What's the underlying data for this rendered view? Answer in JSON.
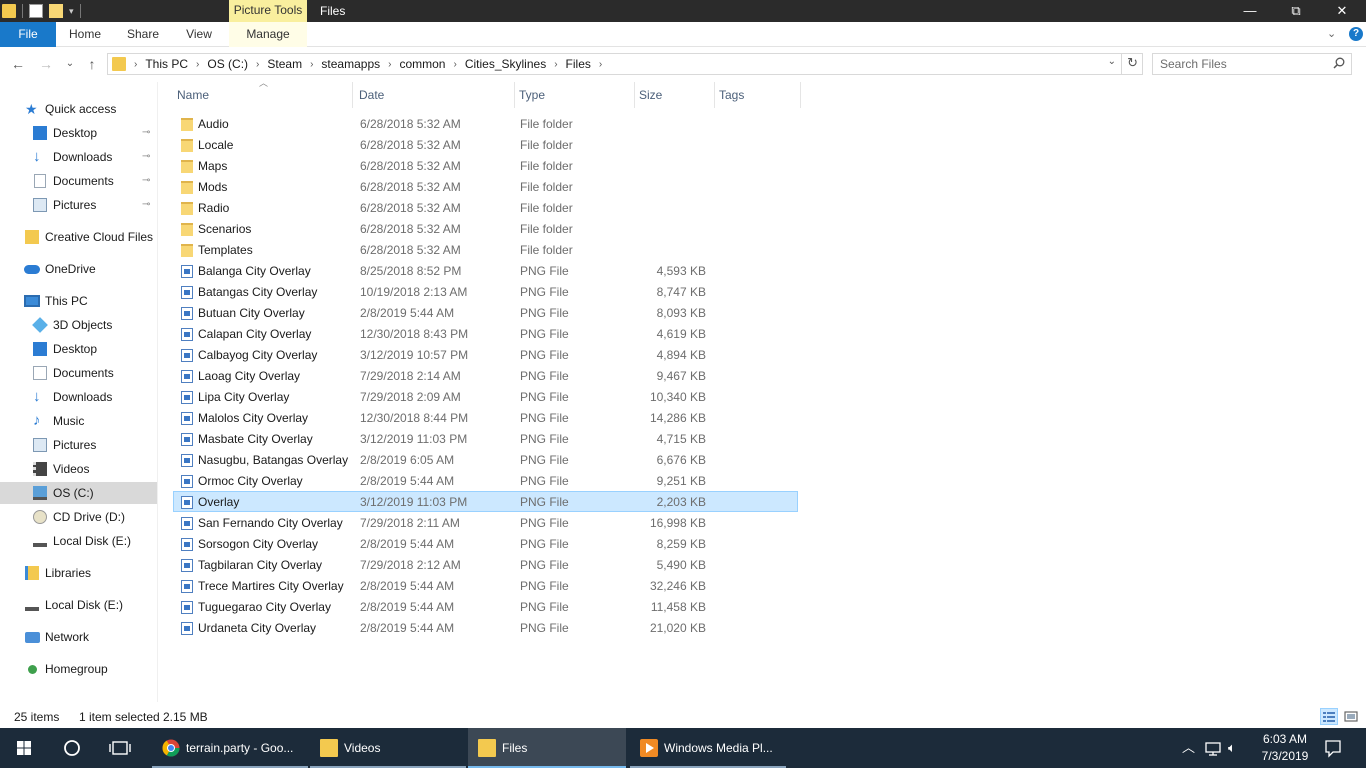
{
  "titlebar": {
    "context_tab": "Picture Tools",
    "title": "Files",
    "minimize": "—",
    "restore": "⧉",
    "close": "✕"
  },
  "ribbon": {
    "tabs": [
      "File",
      "Home",
      "Share",
      "View",
      "Manage"
    ],
    "expand_glyph": "⌄",
    "help_glyph": "?"
  },
  "nav": {
    "back": "←",
    "forward": "→",
    "recent": "⌄",
    "up": "↑",
    "breadcrumb": [
      "This PC",
      "OS (C:)",
      "Steam",
      "steamapps",
      "common",
      "Cities_Skylines",
      "Files"
    ],
    "separator": "›",
    "dropdown": "⌄",
    "refresh": "↻",
    "search_placeholder": "Search Files"
  },
  "sidebar": {
    "quick_access": "Quick access",
    "quick_items": [
      {
        "label": "Desktop",
        "icon": "desktop-icon"
      },
      {
        "label": "Downloads",
        "icon": "downloads-icon"
      },
      {
        "label": "Documents",
        "icon": "documents-icon"
      },
      {
        "label": "Pictures",
        "icon": "pictures-icon"
      }
    ],
    "pin_glyph": "📌",
    "creative_cloud": "Creative Cloud Files",
    "onedrive": "OneDrive",
    "this_pc": "This PC",
    "pc_items": [
      {
        "label": "3D Objects",
        "icon": "3d-objects-icon"
      },
      {
        "label": "Desktop",
        "icon": "desktop-icon"
      },
      {
        "label": "Documents",
        "icon": "documents-icon"
      },
      {
        "label": "Downloads",
        "icon": "downloads-icon"
      },
      {
        "label": "Music",
        "icon": "music-icon"
      },
      {
        "label": "Pictures",
        "icon": "pictures-icon"
      },
      {
        "label": "Videos",
        "icon": "videos-icon"
      },
      {
        "label": "OS (C:)",
        "icon": "os-drive-icon"
      },
      {
        "label": "CD Drive (D:)",
        "icon": "cd-drive-icon"
      },
      {
        "label": "Local Disk (E:)",
        "icon": "local-disk-icon"
      }
    ],
    "libraries": "Libraries",
    "local_disk": "Local Disk (E:)",
    "network": "Network",
    "homegroup": "Homegroup"
  },
  "columns": {
    "name": "Name",
    "date": "Date",
    "type": "Type",
    "size": "Size",
    "tags": "Tags"
  },
  "files": [
    {
      "name": "Audio",
      "date": "6/28/2018 5:32 AM",
      "type": "File folder",
      "size": "",
      "kind": "folder"
    },
    {
      "name": "Locale",
      "date": "6/28/2018 5:32 AM",
      "type": "File folder",
      "size": "",
      "kind": "folder"
    },
    {
      "name": "Maps",
      "date": "6/28/2018 5:32 AM",
      "type": "File folder",
      "size": "",
      "kind": "folder"
    },
    {
      "name": "Mods",
      "date": "6/28/2018 5:32 AM",
      "type": "File folder",
      "size": "",
      "kind": "folder"
    },
    {
      "name": "Radio",
      "date": "6/28/2018 5:32 AM",
      "type": "File folder",
      "size": "",
      "kind": "folder"
    },
    {
      "name": "Scenarios",
      "date": "6/28/2018 5:32 AM",
      "type": "File folder",
      "size": "",
      "kind": "folder"
    },
    {
      "name": "Templates",
      "date": "6/28/2018 5:32 AM",
      "type": "File folder",
      "size": "",
      "kind": "folder"
    },
    {
      "name": "Balanga City Overlay",
      "date": "8/25/2018 8:52 PM",
      "type": "PNG File",
      "size": "4,593 KB",
      "kind": "png"
    },
    {
      "name": "Batangas City Overlay",
      "date": "10/19/2018 2:13 AM",
      "type": "PNG File",
      "size": "8,747 KB",
      "kind": "png"
    },
    {
      "name": "Butuan City Overlay",
      "date": "2/8/2019 5:44 AM",
      "type": "PNG File",
      "size": "8,093 KB",
      "kind": "png"
    },
    {
      "name": "Calapan City Overlay",
      "date": "12/30/2018 8:43 PM",
      "type": "PNG File",
      "size": "4,619 KB",
      "kind": "png"
    },
    {
      "name": "Calbayog City Overlay",
      "date": "3/12/2019 10:57 PM",
      "type": "PNG File",
      "size": "4,894 KB",
      "kind": "png"
    },
    {
      "name": "Laoag City Overlay",
      "date": "7/29/2018 2:14 AM",
      "type": "PNG File",
      "size": "9,467 KB",
      "kind": "png"
    },
    {
      "name": "Lipa City Overlay",
      "date": "7/29/2018 2:09 AM",
      "type": "PNG File",
      "size": "10,340 KB",
      "kind": "png"
    },
    {
      "name": "Malolos City Overlay",
      "date": "12/30/2018 8:44 PM",
      "type": "PNG File",
      "size": "14,286 KB",
      "kind": "png"
    },
    {
      "name": "Masbate City Overlay",
      "date": "3/12/2019 11:03 PM",
      "type": "PNG File",
      "size": "4,715 KB",
      "kind": "png"
    },
    {
      "name": "Nasugbu, Batangas Overlay",
      "date": "2/8/2019 6:05 AM",
      "type": "PNG File",
      "size": "6,676 KB",
      "kind": "png"
    },
    {
      "name": "Ormoc City Overlay",
      "date": "2/8/2019 5:44 AM",
      "type": "PNG File",
      "size": "9,251 KB",
      "kind": "png"
    },
    {
      "name": "Overlay",
      "date": "3/12/2019 11:03 PM",
      "type": "PNG File",
      "size": "2,203 KB",
      "kind": "png",
      "selected": true
    },
    {
      "name": "San Fernando City Overlay",
      "date": "7/29/2018 2:11 AM",
      "type": "PNG File",
      "size": "16,998 KB",
      "kind": "png"
    },
    {
      "name": "Sorsogon City Overlay",
      "date": "2/8/2019 5:44 AM",
      "type": "PNG File",
      "size": "8,259 KB",
      "kind": "png"
    },
    {
      "name": "Tagbilaran City Overlay",
      "date": "7/29/2018 2:12 AM",
      "type": "PNG File",
      "size": "5,490 KB",
      "kind": "png"
    },
    {
      "name": "Trece Martires City Overlay",
      "date": "2/8/2019 5:44 AM",
      "type": "PNG File",
      "size": "32,246 KB",
      "kind": "png"
    },
    {
      "name": "Tuguegarao City Overlay",
      "date": "2/8/2019 5:44 AM",
      "type": "PNG File",
      "size": "11,458 KB",
      "kind": "png"
    },
    {
      "name": "Urdaneta City Overlay",
      "date": "2/8/2019 5:44 AM",
      "type": "PNG File",
      "size": "21,020 KB",
      "kind": "png"
    }
  ],
  "status": {
    "item_count": "25 items",
    "selection": "1 item selected",
    "selection_size": "2.15 MB"
  },
  "taskbar": {
    "tasks": [
      {
        "label": "terrain.party - Goo...",
        "icon": "chrome-icon"
      },
      {
        "label": "Videos",
        "icon": "folder-icon"
      },
      {
        "label": "Files",
        "icon": "folder-icon"
      },
      {
        "label": "Windows Media Pl...",
        "icon": "media-player-icon"
      }
    ],
    "time": "6:03 AM",
    "date": "7/3/2019"
  },
  "colors": {
    "accent": "#1979ca",
    "selection": "#cce8ff",
    "selection_border": "#99d1ff",
    "taskbar": "#1c2b3a",
    "titlebar": "#2b2b2b",
    "context_tab": "#f9ef9e",
    "folder": "#f8d775"
  }
}
